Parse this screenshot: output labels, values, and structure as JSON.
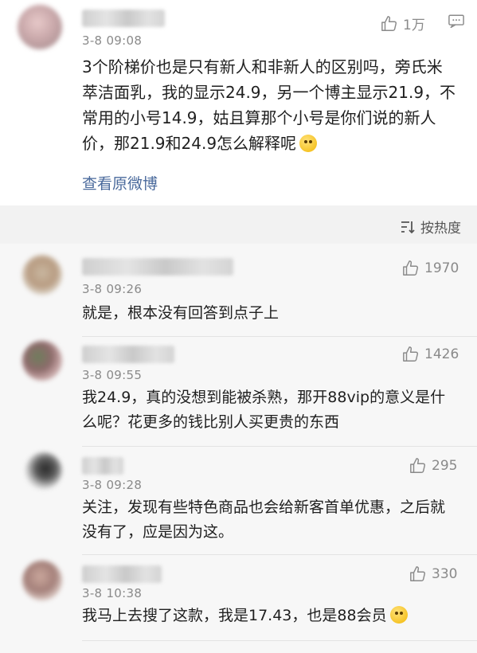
{
  "top_post": {
    "time": "3-8 09:08",
    "like_count": "1万",
    "text": "3个阶梯价也是只有新人和非新人的区别吗，旁氏米萃洁面乳，我的显示24.9，另一个博主显示21.9，不常用的小号14.9，姑且算那个小号是你们说的新人价，那21.9和24.9怎么解释呢",
    "view_original": "查看原微博"
  },
  "sort": {
    "label": "按热度"
  },
  "comments": [
    {
      "time": "3-8 09:26",
      "likes": "1970",
      "text": "就是，根本没有回答到点子上"
    },
    {
      "time": "3-8 09:55",
      "likes": "1426",
      "text": "我24.9，真的没想到能被杀熟，那开88vip的意义是什么呢？花更多的钱比别人买更贵的东西"
    },
    {
      "time": "3-8 09:28",
      "likes": "295",
      "text": "关注，发现有些特色商品也会给新客首单优惠，之后就没有了，应是因为这。"
    },
    {
      "time": "3-8 10:38",
      "likes": "330",
      "text": "我马上去搜了这款，我是17.43，也是88会员"
    }
  ],
  "icons": {
    "like": "thumbs-up-icon",
    "comment": "comment-icon",
    "sort": "sort-icon",
    "emoji": "emoji-icon"
  },
  "colors": {
    "link": "#4a6a9c",
    "meta": "#8a8a8a"
  }
}
